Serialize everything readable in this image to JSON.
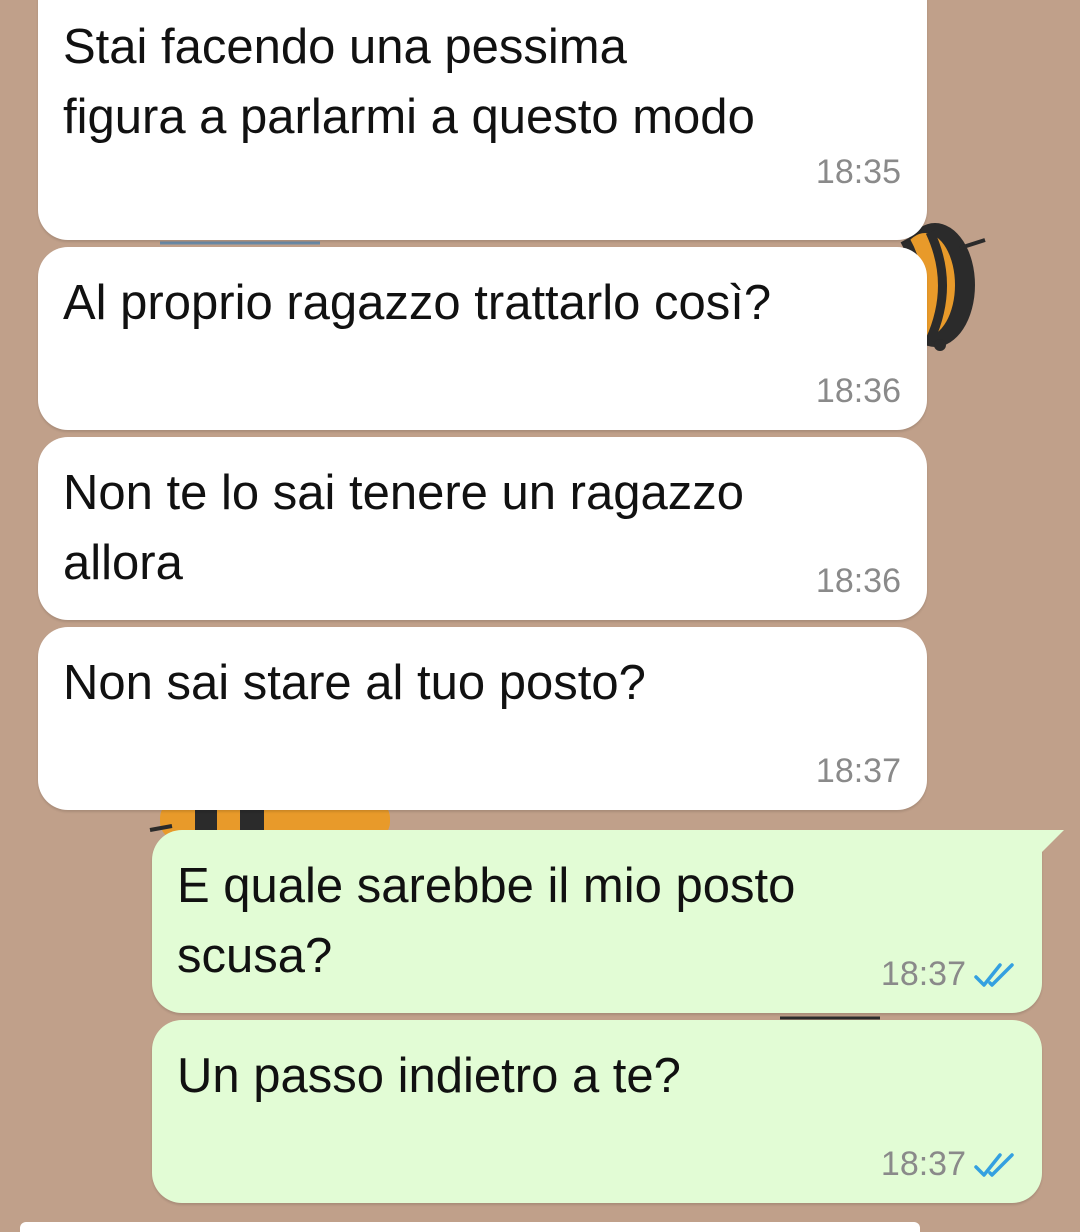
{
  "chat": {
    "messages": [
      {
        "direction": "incoming",
        "text": "Stai facendo una pessima\nfigura a parlarmi a questo modo",
        "time": "18:35"
      },
      {
        "direction": "incoming",
        "text": "Al proprio ragazzo trattarlo così?",
        "time": "18:36"
      },
      {
        "direction": "incoming",
        "text": "Non te lo sai tenere un ragazzo\nallora",
        "time": "18:36"
      },
      {
        "direction": "incoming",
        "text": "Non sai stare al tuo posto?",
        "time": "18:37"
      },
      {
        "direction": "outgoing",
        "text": "E quale sarebbe il mio posto\nscusa?",
        "time": "18:37",
        "status_icon": "double-check-read-icon"
      },
      {
        "direction": "outgoing",
        "text": "Un passo indietro a te?",
        "time": "18:37",
        "status_icon": "double-check-read-icon"
      }
    ]
  },
  "colors": {
    "wallpaper": "#c0a08a",
    "incoming_bubble": "#ffffff",
    "outgoing_bubble": "#e2fcd5",
    "read_ticks": "#34a0e0",
    "timestamp": "#8a8a8a"
  }
}
